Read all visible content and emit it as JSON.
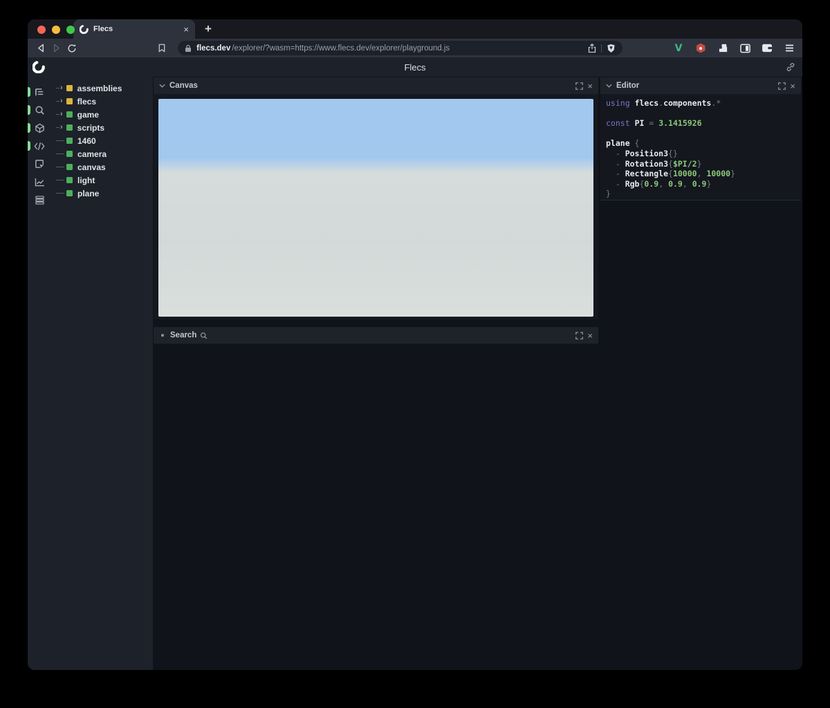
{
  "browser": {
    "tab": {
      "title": "Flecs",
      "close_label": "×",
      "new_tab_label": "+"
    },
    "url": {
      "domain": "flecs.dev",
      "path": "/explorer/?wasm=https://www.flecs.dev/explorer/playground.js"
    }
  },
  "app": {
    "title": "Flecs",
    "sidebar": {
      "items": [
        {
          "name": "entity-tree-icon",
          "active": true
        },
        {
          "name": "search-icon",
          "active": true
        },
        {
          "name": "entities-cube-icon",
          "active": true
        },
        {
          "name": "code-icon",
          "active": true
        },
        {
          "name": "inspect-icon",
          "active": false
        },
        {
          "name": "stats-chart-icon",
          "active": false
        },
        {
          "name": "rows-icon",
          "active": false
        }
      ]
    },
    "tree": {
      "items": [
        {
          "label": "assemblies",
          "color": "yellow",
          "expandable": true
        },
        {
          "label": "flecs",
          "color": "yellow",
          "expandable": true
        },
        {
          "label": "game",
          "color": "green",
          "expandable": true
        },
        {
          "label": "scripts",
          "color": "green",
          "expandable": true
        },
        {
          "label": "1460",
          "color": "green",
          "expandable": false
        },
        {
          "label": "camera",
          "color": "green",
          "expandable": false
        },
        {
          "label": "canvas",
          "color": "green",
          "expandable": false
        },
        {
          "label": "light",
          "color": "green",
          "expandable": false
        },
        {
          "label": "plane",
          "color": "green",
          "expandable": false
        }
      ]
    },
    "panels": {
      "canvas": {
        "title": "Canvas",
        "close_label": "×"
      },
      "search": {
        "title": "Search",
        "close_label": "×"
      },
      "editor": {
        "title": "Editor",
        "close_label": "×",
        "code_lines": [
          [
            [
              "k",
              "using"
            ],
            [
              "p",
              " "
            ],
            [
              "i",
              "flecs"
            ],
            [
              "p",
              "."
            ],
            [
              "i",
              "components"
            ],
            [
              "p",
              "."
            ],
            [
              "p",
              "*"
            ]
          ],
          [],
          [
            [
              "k",
              "const"
            ],
            [
              "p",
              " "
            ],
            [
              "i",
              "PI"
            ],
            [
              "p",
              " = "
            ],
            [
              "n",
              "3.1415926"
            ]
          ],
          [],
          [
            [
              "i",
              "plane"
            ],
            [
              "p",
              " {"
            ]
          ],
          [
            [
              "p",
              "  - "
            ],
            [
              "i",
              "Position3"
            ],
            [
              "p",
              "{}"
            ]
          ],
          [
            [
              "p",
              "  - "
            ],
            [
              "i",
              "Rotation3"
            ],
            [
              "p",
              "{"
            ],
            [
              "n",
              "$PI/2"
            ],
            [
              "p",
              "}"
            ]
          ],
          [
            [
              "p",
              "  - "
            ],
            [
              "i",
              "Rectangle"
            ],
            [
              "p",
              "{"
            ],
            [
              "n",
              "10000"
            ],
            [
              "p",
              ", "
            ],
            [
              "n",
              "10000"
            ],
            [
              "p",
              "}"
            ]
          ],
          [
            [
              "p",
              "  - "
            ],
            [
              "i",
              "Rgb"
            ],
            [
              "p",
              "{"
            ],
            [
              "n",
              "0.9"
            ],
            [
              "p",
              ", "
            ],
            [
              "n",
              "0.9"
            ],
            [
              "p",
              ", "
            ],
            [
              "n",
              "0.9"
            ],
            [
              "p",
              "}"
            ]
          ],
          [
            [
              "p",
              "}"
            ]
          ]
        ]
      }
    },
    "colors": {
      "accent_green": "#85dd95",
      "tree_yellow": "#ddb53c",
      "tree_green": "#4fae5e",
      "code_keyword": "#7d74c9",
      "code_number": "#8cc87a",
      "sky_blue": "#a2c8ef",
      "ground_gray": "#d8dedd"
    }
  }
}
